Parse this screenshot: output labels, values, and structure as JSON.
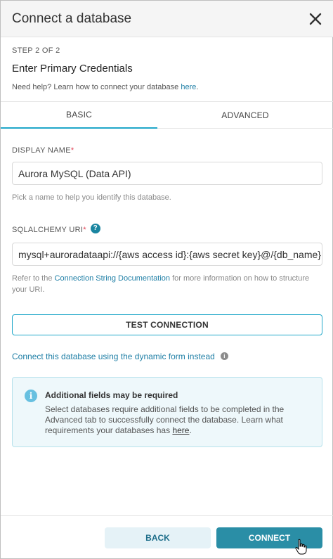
{
  "header": {
    "title": "Connect a database",
    "close_icon": "close-icon"
  },
  "step": {
    "label": "STEP 2 OF 2",
    "title": "Enter Primary Credentials"
  },
  "help": {
    "text": "Need help? Learn how to connect your database ",
    "link": "here",
    "suffix": "."
  },
  "tabs": [
    {
      "label": "BASIC",
      "active": true
    },
    {
      "label": "ADVANCED",
      "active": false
    }
  ],
  "display_name": {
    "label": "DISPLAY NAME",
    "required_mark": "*",
    "value": "Aurora MySQL (Data API)",
    "hint": "Pick a name to help you identify this database."
  },
  "sqlalchemy_uri": {
    "label": "SQLALCHEMY URI",
    "required_mark": "*",
    "help_icon": "question-circle-icon",
    "value": "mysql+auroradataapi://{aws access id}:{aws secret key}@/{db_name}",
    "hint_prefix": "Refer to the ",
    "hint_link": "Connection String Documentation",
    "hint_suffix": " for more information on how to structure your URI."
  },
  "test_button": {
    "label": "TEST CONNECTION"
  },
  "dynamic_form_link": {
    "label": "Connect this database using the dynamic form instead",
    "icon": "info-circle-icon"
  },
  "alert": {
    "icon": "info-icon",
    "title": "Additional fields may be required",
    "body": "Select databases require additional fields to be completed in the Advanced tab to successfully connect the database. Learn what requirements your databases has ",
    "link": "here",
    "suffix": "."
  },
  "footer": {
    "back_label": "BACK",
    "connect_label": "CONNECT"
  },
  "colors": {
    "accent": "#20a7c9",
    "primary_button": "#2a8ea6",
    "link": "#1f7fa6",
    "required": "#e04355"
  }
}
